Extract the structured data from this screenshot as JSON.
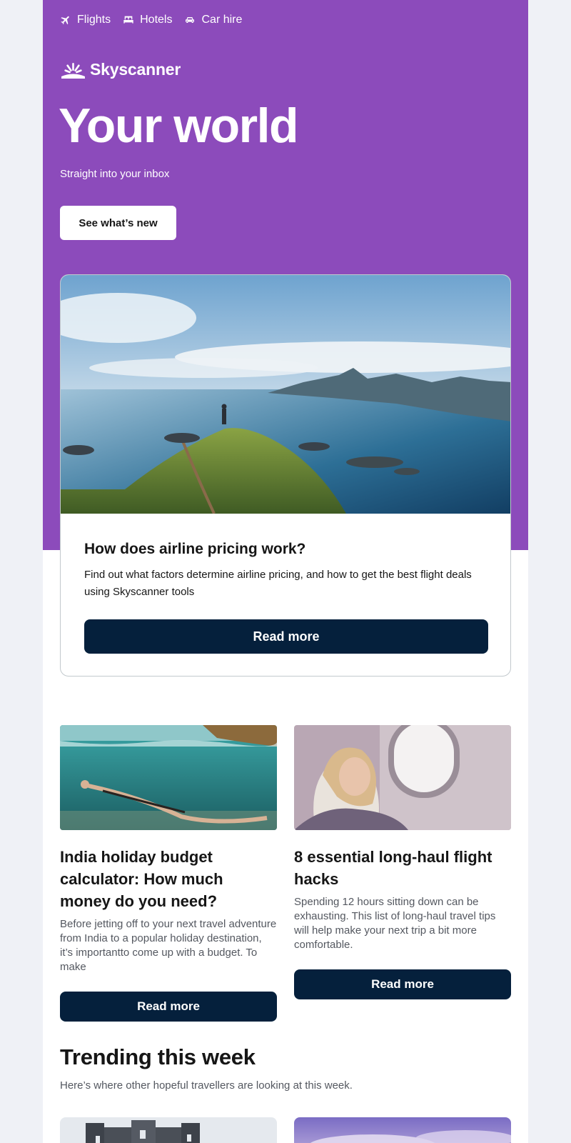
{
  "nav": {
    "items": [
      {
        "label": "Flights",
        "icon": "plane-icon"
      },
      {
        "label": "Hotels",
        "icon": "bed-icon"
      },
      {
        "label": "Car hire",
        "icon": "car-icon"
      }
    ]
  },
  "brand": {
    "name": "Skyscanner",
    "icon": "sunrise-logo-icon"
  },
  "hero": {
    "headline": "Your world",
    "subhead": "Straight into your inbox",
    "button_label": "See what’s new"
  },
  "feature": {
    "image": "hiker-overlooking-fjord-islands",
    "title": "How does airline pricing work?",
    "text": "Find out what factors determine airline pricing, and how to get the best flight deals using Skyscanner tools",
    "button_label": "Read more"
  },
  "articles": [
    {
      "image": "swimmer-underwater-split-view",
      "title": "India holiday budget calculator: How much money do you need?",
      "text": "Before jetting off to your next travel adventure from India to a popular holiday destination, it’s importantto come up with a budget. To make",
      "button_label": "Read more"
    },
    {
      "image": "woman-sleeping-by-plane-window",
      "title": "8 essential long-haul flight hacks",
      "text": "Spending 12 hours sitting down can be exhausting. This list of long-haul travel tips will help make your next trip a bit more comfortable.",
      "button_label": "Read more"
    }
  ],
  "trending": {
    "title": "Trending this week",
    "subtitle": "Here’s where other hopeful travellers are looking at this week.",
    "cards": [
      {
        "image": "castle-towers"
      },
      {
        "image": "purple-sky-clouds"
      }
    ]
  },
  "colors": {
    "hero_purple": "#8c4bbb",
    "button_navy": "#05203c",
    "page_bg": "#eff1f6"
  }
}
